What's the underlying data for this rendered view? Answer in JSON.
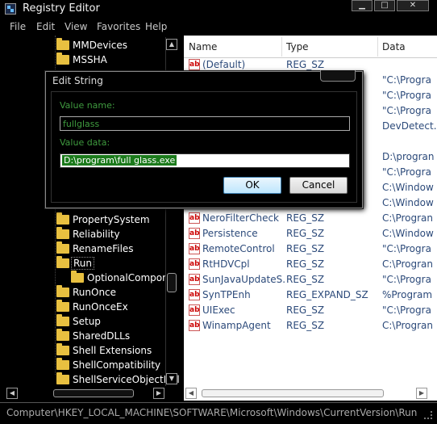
{
  "window": {
    "title": "Registry Editor",
    "controls": [
      "minimize-icon",
      "maximize-icon",
      "close-icon"
    ]
  },
  "menu": [
    "File",
    "Edit",
    "View",
    "Favorites",
    "Help"
  ],
  "tree": {
    "top_items": [
      "MMDevices",
      "MSSHA"
    ],
    "items": [
      "PropertySystem",
      "Reliability",
      "RenameFiles",
      "Run",
      "OptionalCompone",
      "RunOnce",
      "RunOnceEx",
      "Setup",
      "SharedDLLs",
      "Shell Extensions",
      "ShellCompatibility",
      "ShellServiceObjectDel"
    ],
    "selected": "Run"
  },
  "list": {
    "columns": [
      "Name",
      "Type",
      "Data"
    ],
    "top_row": {
      "name": "(Default)",
      "type": "REG_SZ",
      "data": ""
    },
    "partial_data": [
      "\"C:\\Progra",
      "\"C:\\Progra",
      "\"C:\\Progra",
      "DevDetect.",
      "D:\\progran",
      "\"C:\\Progra",
      "C:\\Window",
      "C:\\Window"
    ],
    "rows": [
      {
        "name": "NeroFilterCheck",
        "type": "REG_SZ",
        "data": "C:\\Progran"
      },
      {
        "name": "Persistence",
        "type": "REG_SZ",
        "data": "C:\\Window"
      },
      {
        "name": "RemoteControl",
        "type": "REG_SZ",
        "data": "\"C:\\Progra"
      },
      {
        "name": "RtHDVCpl",
        "type": "REG_SZ",
        "data": "C:\\Progran"
      },
      {
        "name": "SunJavaUpdateS...",
        "type": "REG_SZ",
        "data": "\"C:\\Progra"
      },
      {
        "name": "SynTPEnh",
        "type": "REG_EXPAND_SZ",
        "data": "%Program"
      },
      {
        "name": "UIExec",
        "type": "REG_SZ",
        "data": "\"C:\\Progra"
      },
      {
        "name": "WinampAgent",
        "type": "REG_SZ",
        "data": "C:\\Progran"
      }
    ]
  },
  "status": {
    "path": "Computer\\HKEY_LOCAL_MACHINE\\SOFTWARE\\Microsoft\\Windows\\CurrentVersion\\Run"
  },
  "dialog": {
    "title": "Edit String",
    "value_name_label": "Value name:",
    "value_name": "fullglass",
    "value_data_label": "Value data:",
    "value_data": "D:\\program\\full glass.exe",
    "ok": "OK",
    "cancel": "Cancel"
  },
  "colors": {
    "accent_green": "#3f9b3f",
    "selection_green": "#1b7a1b",
    "list_text": "#2c4a7a",
    "folder": "#e8c040"
  }
}
